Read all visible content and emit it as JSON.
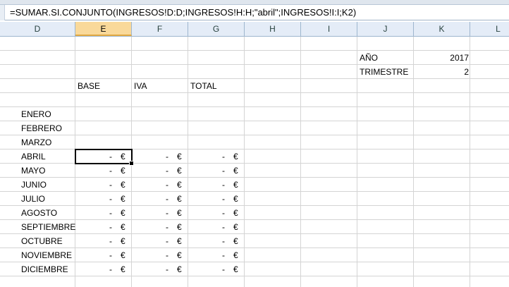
{
  "formula_bar": {
    "formula": "=SUMAR.SI.CONJUNTO(INGRESOS!D:D;INGRESOS!H:H;\"abril\";INGRESOS!I:I;K2)"
  },
  "columns": [
    "D",
    "E",
    "F",
    "G",
    "H",
    "I",
    "J",
    "K",
    "L"
  ],
  "active_column": "E",
  "params": {
    "year_label": "AÑO",
    "year_value": "2017",
    "quarter_label": "TRIMESTRE",
    "quarter_value": "2"
  },
  "headers": {
    "base": "BASE",
    "iva": "IVA",
    "total": "TOTAL"
  },
  "months": [
    "ENERO",
    "FEBRERO",
    "MARZO",
    "ABRIL",
    "MAYO",
    "JUNIO",
    "JULIO",
    "AGOSTO",
    "SEPTIEMBRE",
    "OCTUBRE",
    "NOVIEMBRE",
    "DICIEMBRE"
  ],
  "currency": {
    "dash": "-",
    "symbol": "€",
    "first_month_with_values": 3
  }
}
